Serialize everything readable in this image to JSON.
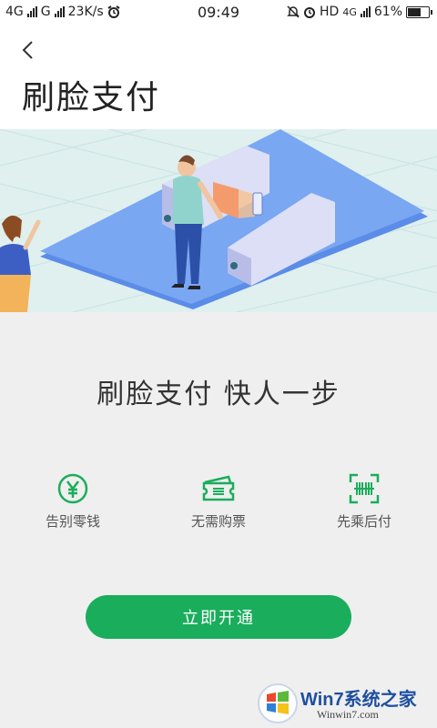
{
  "status_bar": {
    "network_1": "4G",
    "network_2": "G",
    "speed": "23K/s",
    "time": "09:49",
    "hd_label": "HD",
    "network_3": "4G",
    "battery": "61%"
  },
  "header": {
    "title": "刷脸支付"
  },
  "hero": {
    "illustration": "face-pay-gate-illustration"
  },
  "slogan": "刷脸支付 快人一步",
  "features": [
    {
      "label": "告别零钱",
      "icon": "yuan-coin-icon"
    },
    {
      "label": "无需购票",
      "icon": "ticket-icon"
    },
    {
      "label": "先乘后付",
      "icon": "scan-code-icon"
    }
  ],
  "cta": {
    "label": "立即开通"
  },
  "watermark": {
    "text": "Win7系统之家",
    "url": "Winwin7.com"
  },
  "colors": {
    "accent": "#1aad5c",
    "background": "#efefef",
    "hero_bg": "#dff0ef",
    "platform": "#6f9ff0"
  }
}
